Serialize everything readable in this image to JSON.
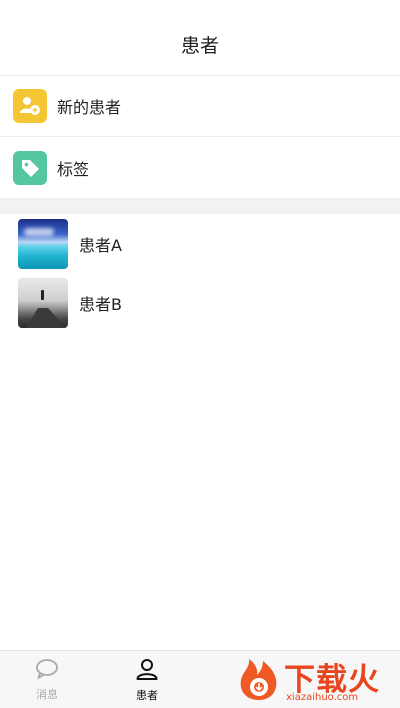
{
  "header": {
    "title": "患者"
  },
  "menu": [
    {
      "label": "新的患者",
      "icon": "add-user-icon",
      "color": "#f5c633"
    },
    {
      "label": "标签",
      "icon": "tag-icon",
      "color": "#54c6a1"
    }
  ],
  "patients": [
    {
      "name": "患者A",
      "avatar": "sea-photo"
    },
    {
      "name": "患者B",
      "avatar": "person-on-rocks-photo"
    }
  ],
  "tabbar": {
    "items": [
      {
        "label": "消息",
        "icon": "chat-bubble-icon",
        "active": false
      },
      {
        "label": "患者",
        "icon": "person-icon",
        "active": true
      }
    ]
  },
  "watermark": {
    "text": "下载火",
    "sub": "xiazaihuo.com"
  }
}
